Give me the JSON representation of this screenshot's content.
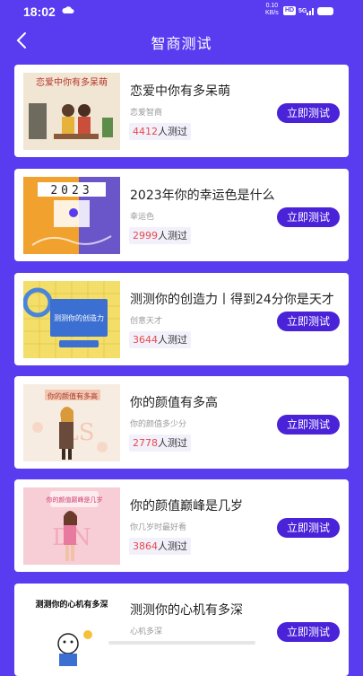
{
  "status": {
    "time": "18:02",
    "net_speed": "0.10",
    "net_unit": "KB/s",
    "hd": "HD",
    "signal": "5G"
  },
  "header": {
    "title": "智商测试"
  },
  "items": [
    {
      "title": "恋爱中你有多呆萌",
      "subtitle": "恋爱智商",
      "count": "4412",
      "count_suffix": "人测过",
      "button": "立即测试",
      "thumb_text": "恋爱中你有多呆萌"
    },
    {
      "title": "2023年你的幸运色是什么",
      "subtitle": "幸运色",
      "count": "2999",
      "count_suffix": "人测过",
      "button": "立即测试",
      "thumb_text": "2023"
    },
    {
      "title": "测测你的创造力丨得到24分你是天才",
      "subtitle": "创意天才",
      "count": "3644",
      "count_suffix": "人测过",
      "button": "立即测试",
      "thumb_text": "测测你的创造力"
    },
    {
      "title": "你的颜值有多高",
      "subtitle": "你的颜值多少分",
      "count": "2778",
      "count_suffix": "人测过",
      "button": "立即测试",
      "thumb_text": "你的颜值有多高"
    },
    {
      "title": "你的颜值巅峰是几岁",
      "subtitle": "你几岁时最好看",
      "count": "3864",
      "count_suffix": "人测过",
      "button": "立即测试",
      "thumb_text": "你的颜值巅峰是几岁"
    },
    {
      "title": "测测你的心机有多深",
      "subtitle": "心机多深",
      "count": "",
      "count_suffix": "",
      "button": "立即测试",
      "thumb_text": "测测你的心机有多深"
    }
  ]
}
